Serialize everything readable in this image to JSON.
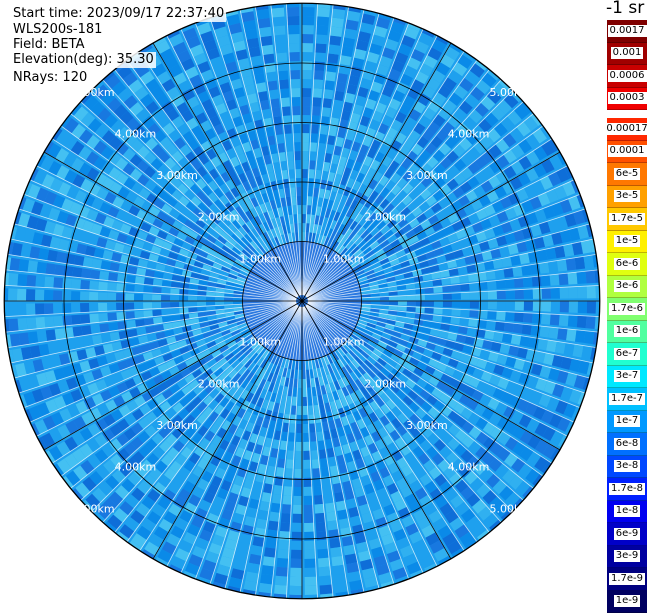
{
  "header": {
    "start_time": "Start time: 2023/09/17 22:37:40",
    "device": "WLS200s-181",
    "field": "Field: BETA",
    "elevation": "Elevation(deg): 35.30",
    "nrays": "NRays: 120"
  },
  "colorbar": {
    "unit": "-1 sr",
    "upper_labels": [
      "0.0017",
      "0.001",
      "0.0006",
      "0.0003"
    ],
    "upper_colors": [
      "#7f0000",
      "#a00000",
      "#c80000",
      "#f00000"
    ],
    "lower_labels": [
      "0.00017",
      "0.0001",
      "6e-5",
      "3e-5",
      "1.7e-5",
      "1e-5",
      "6e-6",
      "3e-6",
      "1.7e-6",
      "1e-6",
      "6e-7",
      "3e-7",
      "1.7e-7",
      "1e-7",
      "6e-8",
      "3e-8",
      "1.7e-8",
      "1e-8",
      "6e-9",
      "3e-9",
      "1.7e-9",
      "1e-9"
    ],
    "lower_colors": [
      "#ff2800",
      "#ff5000",
      "#ff7800",
      "#ffa000",
      "#ffc800",
      "#fff000",
      "#e0ff10",
      "#b0ff40",
      "#80ff70",
      "#50ffa0",
      "#20ffd0",
      "#00e8ff",
      "#00c0ff",
      "#0098ff",
      "#0070ff",
      "#0048ff",
      "#0020ff",
      "#0000f0",
      "#0000c8",
      "#0000a0",
      "#000080",
      "#000060"
    ]
  },
  "ppi": {
    "range_labels": [
      "1.00km",
      "2.00km",
      "3.00km",
      "4.00km",
      "5.00km"
    ],
    "background_color": "#1ea0ee",
    "inner_color": "#2a78e0"
  }
}
